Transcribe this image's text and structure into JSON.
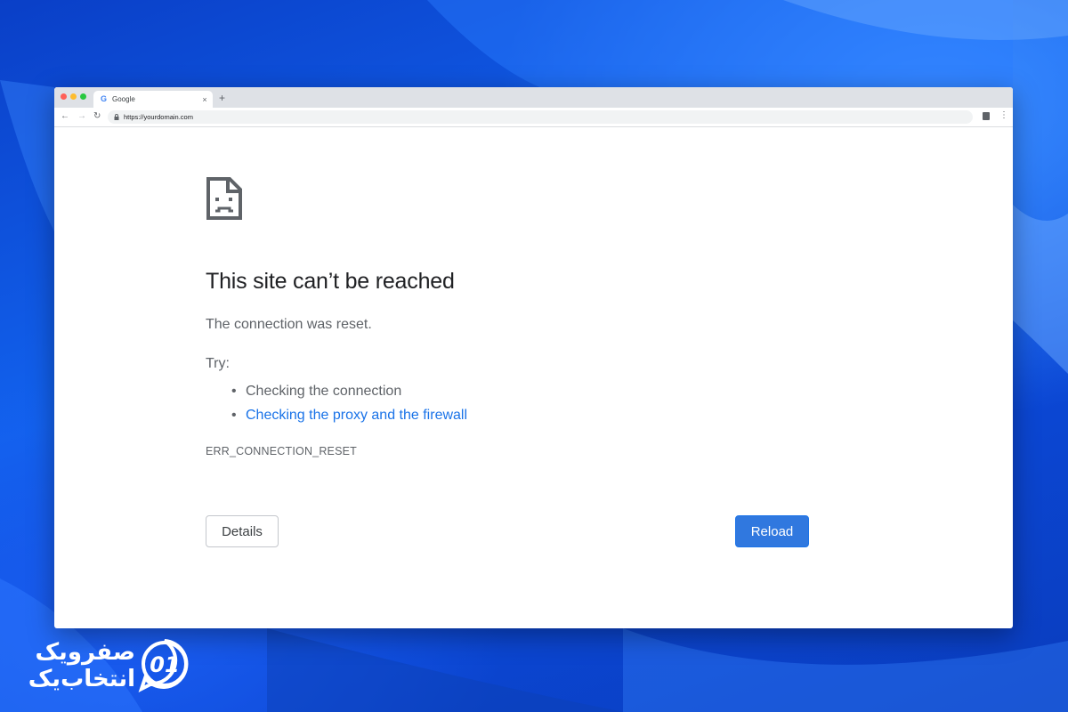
{
  "browser": {
    "tab_title": "Google",
    "tab_favicon": "G",
    "tab_close": "×",
    "new_tab": "+",
    "url": "https://yourdomain.com"
  },
  "error_page": {
    "title": "This site can’t be reached",
    "message": "The connection was reset.",
    "try_label": "Try:",
    "suggestions": [
      {
        "text": "Checking the connection",
        "link": false
      },
      {
        "text": "Checking the proxy and the firewall",
        "link": true
      }
    ],
    "error_code": "ERR_CONNECTION_RESET",
    "details_label": "Details",
    "reload_label": "Reload"
  },
  "watermark": {
    "line1": "صفرویک",
    "line2": "انتخاب‌یک",
    "mark": "01"
  },
  "colors": {
    "accent": "#1a73e8",
    "reload_button": "#3078df",
    "wallpaper": "#0f56d8"
  },
  "icons": {
    "error": "sad-page-icon",
    "lock": "lock-icon",
    "back": "back-arrow-icon",
    "forward": "forward-arrow-icon",
    "reload": "reload-icon",
    "menu": "kebab-menu-icon",
    "profile": "profile-icon"
  }
}
